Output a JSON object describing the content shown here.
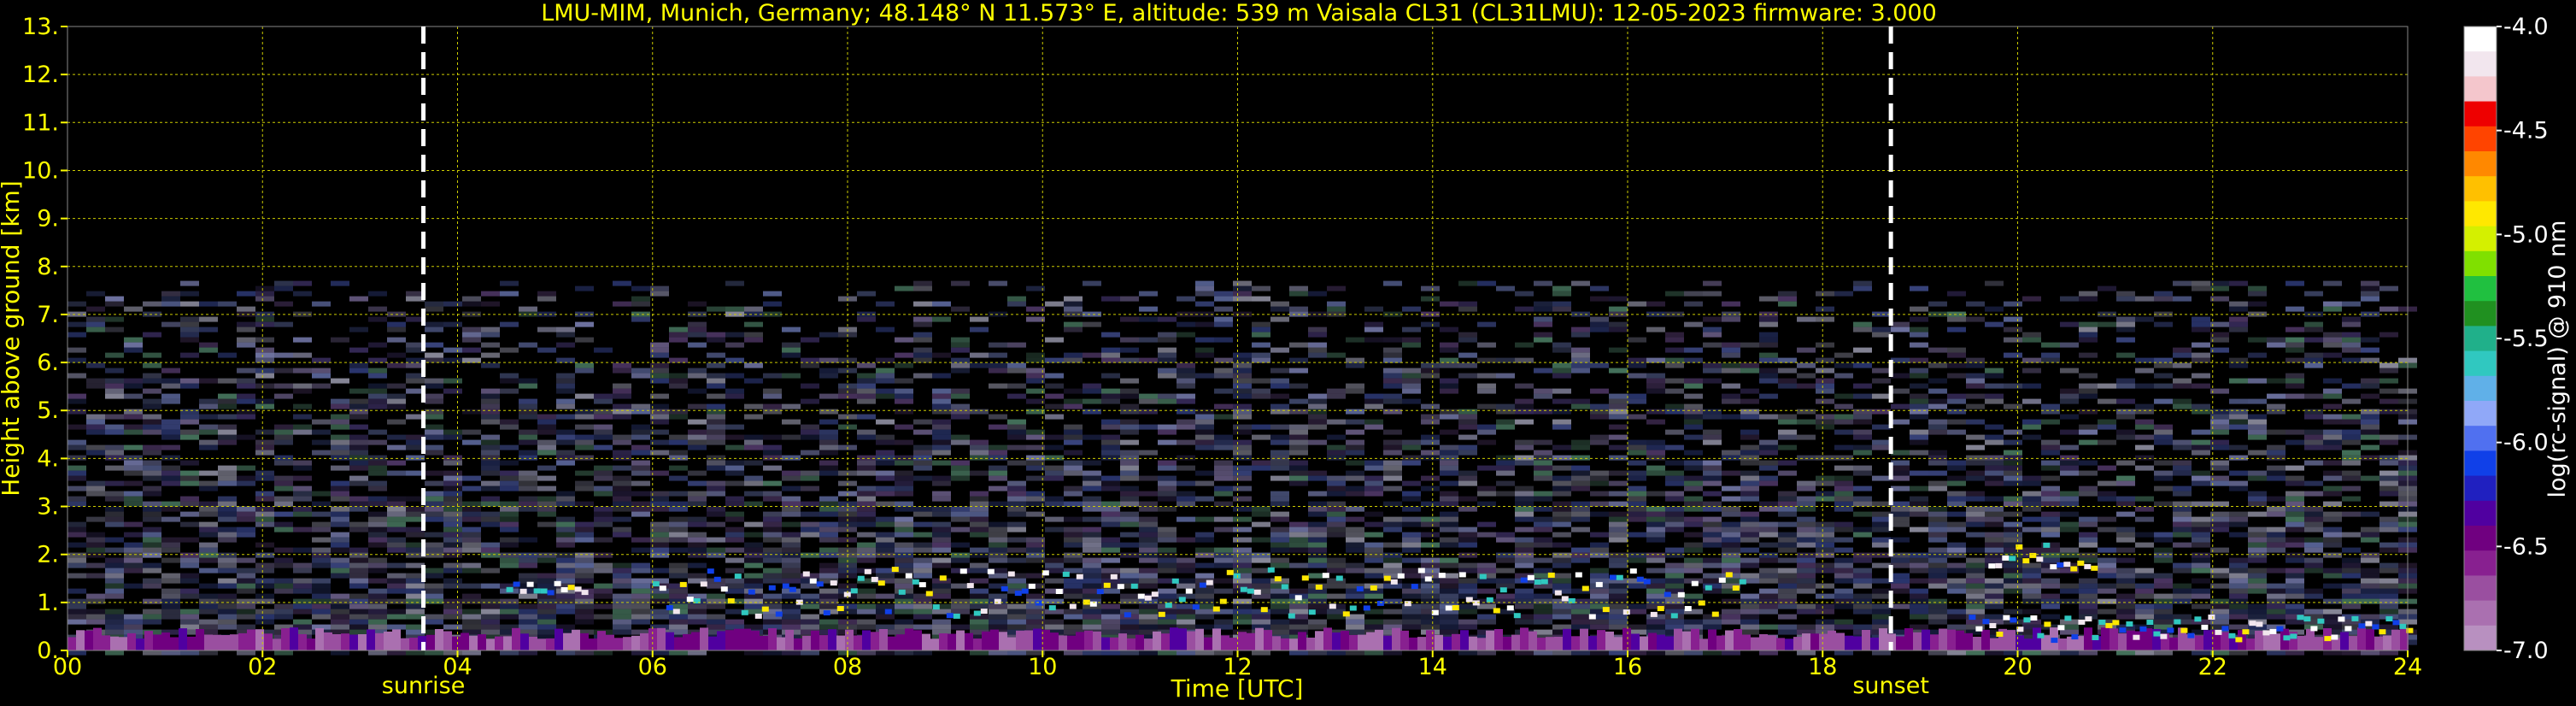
{
  "header": {
    "title": "LMU-MIM, Munich, Germany; 48.148° N 11.573° E, altitude: 539 m    Vaisala CL31 (CL31LMU): 12-05-2023    firmware: 3.000"
  },
  "chart_data": {
    "type": "heatmap",
    "title": "LMU-MIM, Munich, Germany; 48.148° N 11.573° E, altitude: 539 m    Vaisala CL31 (CL31LMU): 12-05-2023    firmware: 3.000",
    "xlabel": "Time [UTC]",
    "ylabel": "Height above ground [km]",
    "xlim": [
      0,
      24
    ],
    "ylim": [
      0,
      13
    ],
    "x_ticks": [
      "00",
      "02",
      "04",
      "06",
      "08",
      "10",
      "12",
      "14",
      "16",
      "18",
      "20",
      "22",
      "24"
    ],
    "y_ticks": [
      "0.",
      "1.",
      "2.",
      "3.",
      "4.",
      "5.",
      "6.",
      "7.",
      "8.",
      "9.",
      "10.",
      "11.",
      "12.",
      "13."
    ],
    "grid": true,
    "events": [
      {
        "label": "sunrise",
        "time": 3.65
      },
      {
        "label": "sunset",
        "time": 18.7
      }
    ],
    "colorbar": {
      "label": "log(rc-signal) @ 910 nm",
      "min": -7.0,
      "max": -4.0,
      "ticks": [
        "-4.0",
        "-4.5",
        "-5.0",
        "-5.5",
        "-6.0",
        "-6.5",
        "-7.0"
      ],
      "colors": [
        "#ffffff",
        "#f2e6ee",
        "#f4c6cc",
        "#ee0000",
        "#ff4400",
        "#ff8800",
        "#ffc000",
        "#ffe800",
        "#d4f000",
        "#80e000",
        "#20c040",
        "#209020",
        "#20b08a",
        "#30c8c0",
        "#60b0e8",
        "#90a8f8",
        "#5070f0",
        "#1040e8",
        "#2020c0",
        "#5000a0",
        "#700080",
        "#882090",
        "#9a4fa0",
        "#aa70b0",
        "#b890c0"
      ]
    },
    "features": [
      {
        "name": "noise-region",
        "x": [
          0,
          24
        ],
        "y": [
          0,
          7.7
        ]
      },
      {
        "name": "boundary-layer",
        "x": [
          0,
          24
        ],
        "y": [
          0,
          0.4
        ]
      },
      {
        "name": "cloud-layer-morning",
        "x": [
          4.5,
          5.3
        ],
        "y": [
          1.2,
          1.4
        ]
      },
      {
        "name": "cloud-layer-day",
        "x": [
          6,
          17.2
        ],
        "y": [
          0.7,
          1.7
        ]
      },
      {
        "name": "cloud-layer-evening",
        "x": [
          19.7,
          20.8
        ],
        "y": [
          1.7,
          2.2
        ]
      },
      {
        "name": "aerosol-layer-evening",
        "x": [
          19.5,
          24
        ],
        "y": [
          0.2,
          0.7
        ]
      }
    ]
  }
}
